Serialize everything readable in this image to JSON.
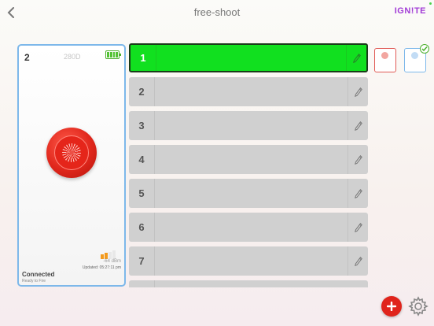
{
  "header": {
    "title": "free-shoot",
    "brand": "IGN!TE"
  },
  "device": {
    "number": "2",
    "model": "280D",
    "battery_level": 1.0,
    "signal_bars_active": 2,
    "signal_bars_total": 4,
    "signal_strength": "-64 dBm",
    "updated": "Updated: 05:27:11 pm",
    "status": "Connected",
    "status_sub": "Ready to Fire"
  },
  "cues": [
    {
      "label": "1",
      "active": true
    },
    {
      "label": "2",
      "active": false
    },
    {
      "label": "3",
      "active": false
    },
    {
      "label": "4",
      "active": false
    },
    {
      "label": "5",
      "active": false
    },
    {
      "label": "6",
      "active": false
    },
    {
      "label": "7",
      "active": false
    },
    {
      "label": "",
      "active": false
    }
  ],
  "colors": {
    "active_cue": "#11e01f",
    "inactive_cue": "#d0d0d0",
    "fire_red": "#e0271c",
    "brand": "#a13ad6",
    "card_border": "#7db8ea"
  },
  "icons": {
    "back": "chevron-left-icon",
    "edit": "pencil-icon",
    "add": "plus-icon",
    "settings": "gear-icon",
    "selected": "checkmark-icon"
  }
}
